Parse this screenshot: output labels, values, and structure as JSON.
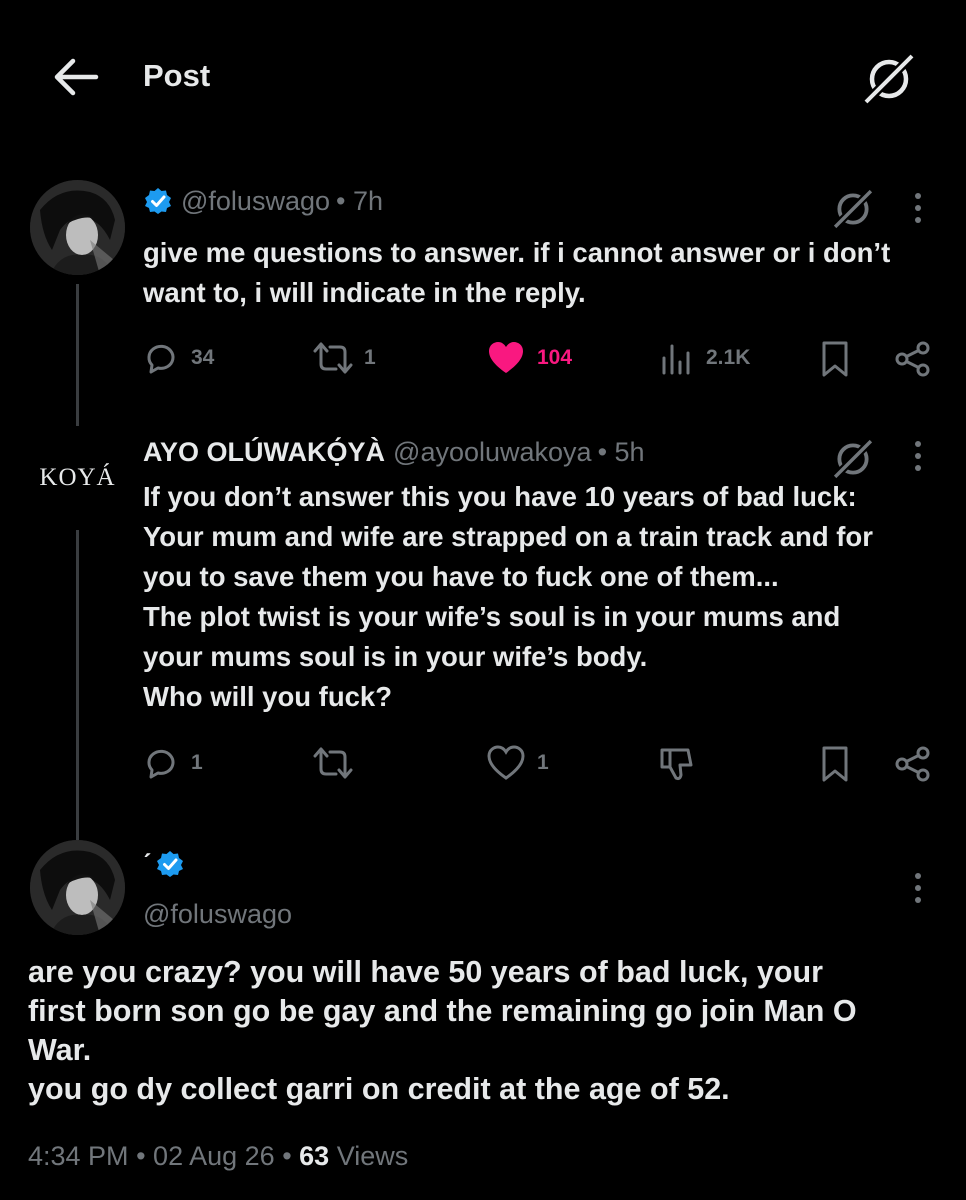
{
  "header": {
    "title": "Post"
  },
  "post1": {
    "handle": "@foluswago",
    "time": "• 7h",
    "text_lines": [
      "give me questions to answer. if i cannot answer or i don’t",
      "want to, i will indicate in the reply."
    ],
    "replies": "34",
    "reposts": "1",
    "likes": "104",
    "views": "2.1K"
  },
  "post2": {
    "avatar_text": "KOYÁ",
    "display_name": "AYO OLÚWAKỌ́YÀ",
    "handle": "@ayooluwakoya",
    "time": "• 5h",
    "text_lines": [
      "If you don’t answer this you have 10 years of bad luck:",
      "Your mum and wife are strapped on a train track and for",
      "you to save them you have to fuck one of them...",
      "The plot twist is your wife’s soul is in your mums and",
      "your mums soul is in your wife’s body.",
      "Who will you fuck?"
    ],
    "replies": "1",
    "likes": "1"
  },
  "post3": {
    "display_name": "ˊ",
    "handle": "@foluswago",
    "text_lines": [
      "are you crazy? you will have 50 years of bad luck, your",
      "first born son go be gay and the remaining go join Man O",
      "War.",
      "you go dy collect garri on credit at the age of 52."
    ],
    "meta_time": "4:34 PM",
    "meta_sep1": "•",
    "meta_date": "02 Aug 26",
    "meta_sep2": "•",
    "meta_views_count": "63",
    "meta_views_label": "Views"
  },
  "colors": {
    "background": "#000000",
    "text": "#e7e9ea",
    "secondary": "#71767b",
    "like_pink": "#f91880",
    "verified_blue": "#1d9bf0"
  },
  "icons": [
    "back-arrow-icon",
    "grok-icon",
    "verified-icon",
    "reply-icon",
    "repost-icon",
    "like-icon",
    "views-icon",
    "bookmark-icon",
    "share-icon",
    "dislike-icon",
    "more-icon"
  ]
}
